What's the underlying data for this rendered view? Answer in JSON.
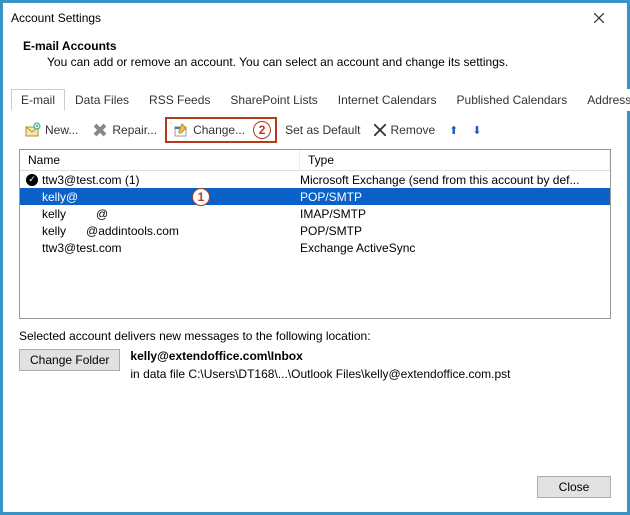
{
  "window": {
    "title": "Account Settings"
  },
  "header": {
    "title": "E-mail Accounts",
    "subtitle": "You can add or remove an account. You can select an account and change its settings."
  },
  "tabs": [
    {
      "label": "E-mail",
      "active": true
    },
    {
      "label": "Data Files"
    },
    {
      "label": "RSS Feeds"
    },
    {
      "label": "SharePoint Lists"
    },
    {
      "label": "Internet Calendars"
    },
    {
      "label": "Published Calendars"
    },
    {
      "label": "Address Books"
    }
  ],
  "toolbar": {
    "new": "New...",
    "repair": "Repair...",
    "change": "Change...",
    "set_default": "Set as Default",
    "remove": "Remove"
  },
  "callouts": {
    "change_num": "2",
    "selected_num": "1"
  },
  "columns": {
    "name": "Name",
    "type": "Type"
  },
  "accounts": [
    {
      "name": "ttw3@test.com (1)",
      "type": "Microsoft Exchange (send from this account by def...",
      "default": true
    },
    {
      "name": "kelly@",
      "type": "POP/SMTP",
      "selected": true
    },
    {
      "name": "kelly         @",
      "type": "IMAP/SMTP"
    },
    {
      "name": "kelly      @addintools.com",
      "type": "POP/SMTP"
    },
    {
      "name": "ttw3@test.com",
      "type": "Exchange ActiveSync"
    }
  ],
  "footer": {
    "intro": "Selected account delivers new messages to the following location:",
    "change_folder": "Change Folder",
    "location_bold": "kelly@extendoffice.com\\Inbox",
    "location_sub": "in data file C:\\Users\\DT168\\...\\Outlook Files\\kelly@extendoffice.com.pst",
    "close": "Close"
  }
}
